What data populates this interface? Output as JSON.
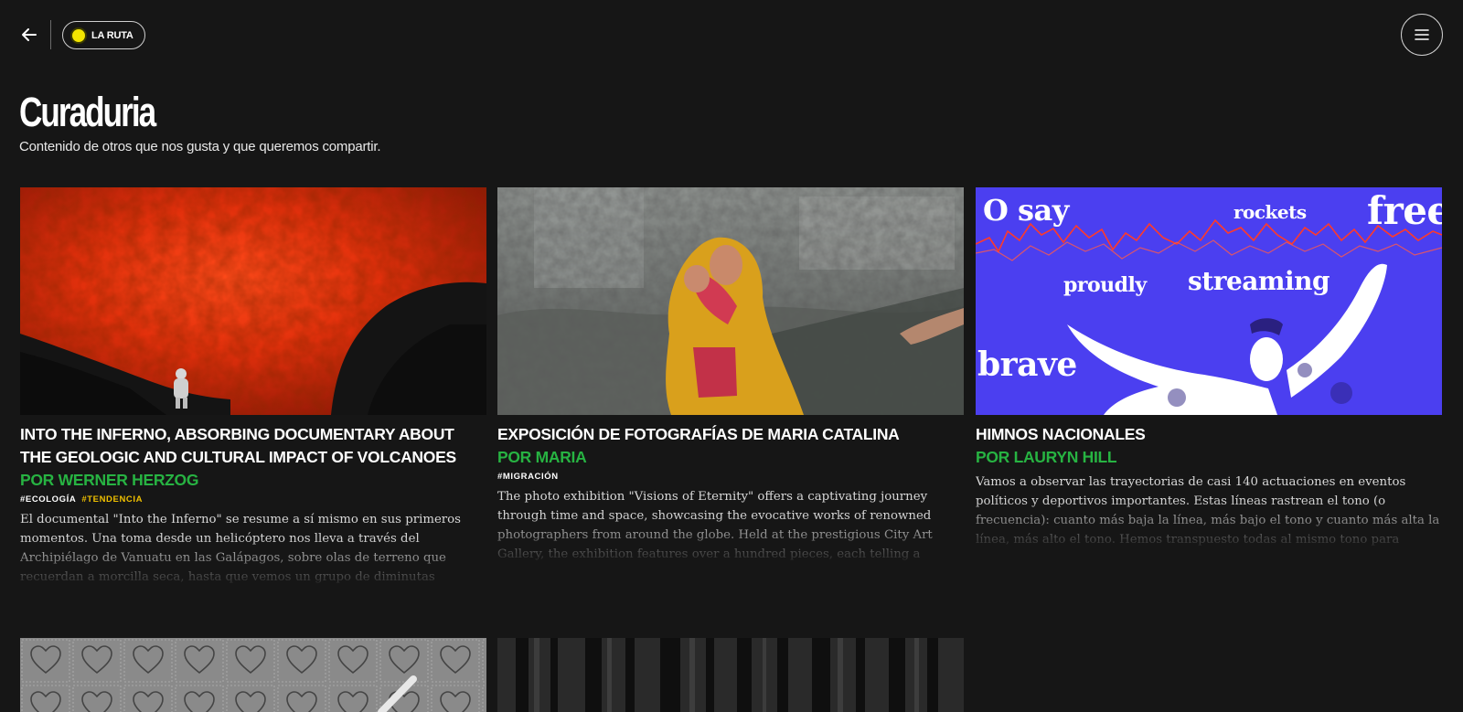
{
  "nav": {
    "badge_label": "LA RUTA",
    "accent_color": "#f3e500"
  },
  "header": {
    "title": "Curaduria",
    "subtitle": "Contenido de otros que nos gusta y que queremos compartir."
  },
  "cards": [
    {
      "title": "Into the Inferno, absorbing documentary about the geologic and cultural impact of volcanoes",
      "author": "Por Werner Herzog",
      "tags": [
        {
          "label": "#ECOLOGÍA",
          "color": "#ffffff"
        },
        {
          "label": "#TENDENCIA",
          "color": "#f0c000"
        }
      ],
      "description": "El documental \"Into the Inferno\" se resume a sí mismo en sus primeros momentos. Una toma desde un helicóptero nos lleva a través del Archipiélago de Vanuatu en las Galápagos, sobre olas de terreno que recuerdan a morcilla seca, hasta que vemos un grupo de diminutas"
    },
    {
      "title": "Exposición de fotografías de Maria Catalina",
      "author": "Por Maria",
      "tags": [
        {
          "label": "#MIGRACIÓN",
          "color": "#ffffff"
        }
      ],
      "description": "The photo exhibition \"Visions of Eternity\" offers a captivating journey through time and space, showcasing the evocative works of renowned photographers from around the globe. Held at the prestigious City Art Gallery, the exhibition features over a hundred pieces, each telling a"
    },
    {
      "title": "Himnos nacionales",
      "author": "Por Lauryn Hill",
      "tags": [],
      "description": "Vamos a observar las trayectorias de casi 140 actuaciones en eventos políticos y deportivos importantes. Estas líneas rastrean el tono (o frecuencia): cuanto más baja la línea, más bajo el tono y cuanto más alta la línea, más alto el tono. Hemos transpuesto todas al mismo tono para"
    }
  ],
  "image_texts": {
    "o_say": "O say",
    "rockets": "rockets",
    "free": "free",
    "proudly": "proudly",
    "streaming": "streaming",
    "brave": "brave"
  },
  "colors": {
    "background": "#161616",
    "author_green": "#27b342",
    "tag_yellow": "#f0c000",
    "anthem_blue": "#4b3ff0"
  },
  "icons": {
    "back": "arrow-left-icon",
    "menu": "hamburger-menu-icon"
  }
}
